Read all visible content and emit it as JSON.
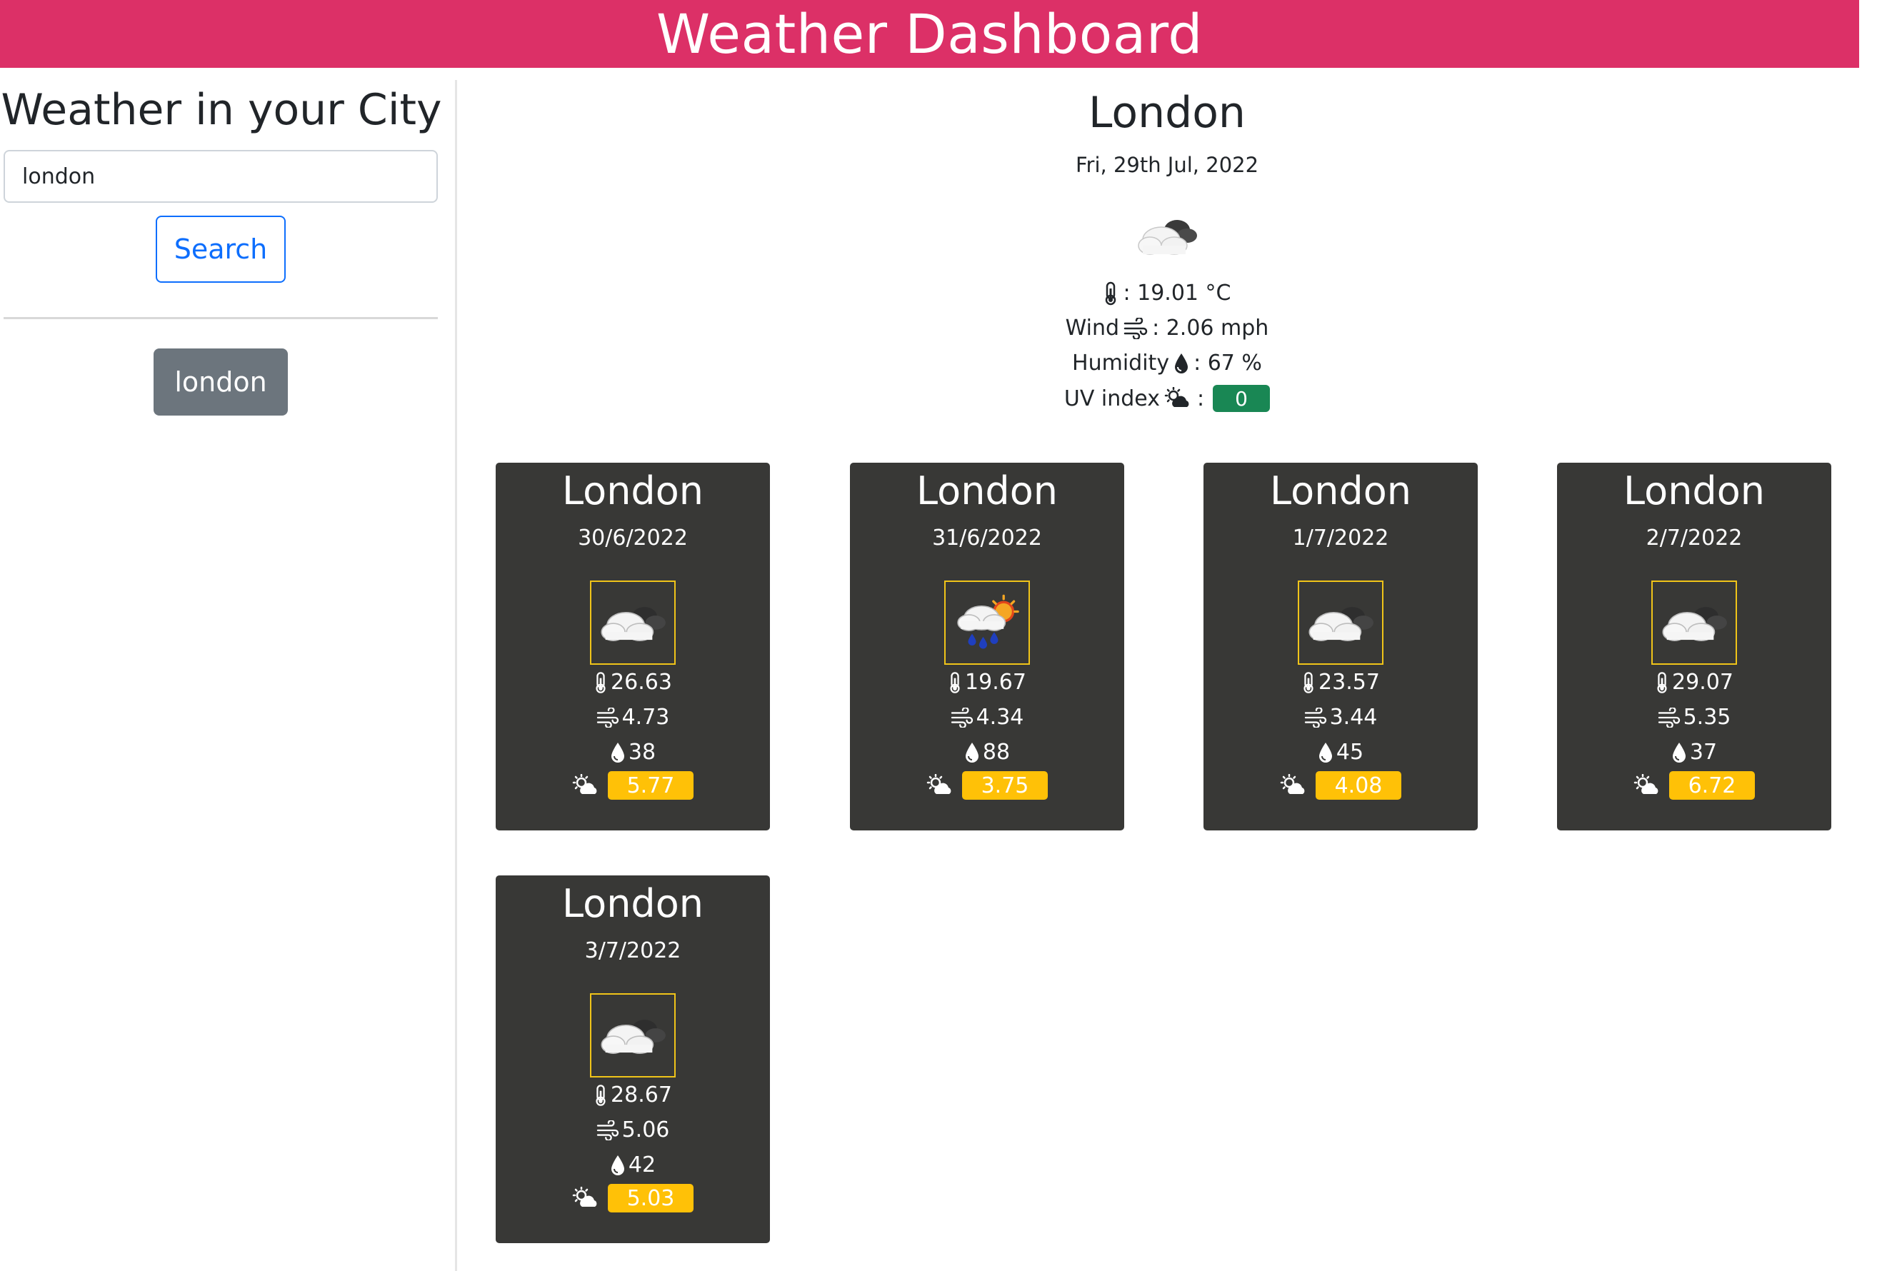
{
  "header": {
    "title": "Weather Dashboard"
  },
  "sidebar": {
    "title": "Weather in your City",
    "search_value": "london",
    "search_button_label": "Search",
    "history": [
      "london"
    ]
  },
  "current": {
    "city": "London",
    "date": "Fri, 29th Jul, 2022",
    "icon": "cloudy-icon",
    "temp": ": 19.01 °C",
    "wind_label": "Wind",
    "wind": ": 2.06 mph",
    "humidity_label": "Humidity",
    "humidity": ": 67 %",
    "uv_label": "UV index",
    "uv_sep": ":",
    "uv": "0",
    "uv_color": "#198754"
  },
  "forecast": [
    {
      "city": "London",
      "date": "30/6/2022",
      "icon": "cloudy-icon",
      "temp": "26.63",
      "wind": "4.73",
      "humidity": "38",
      "uv": "5.77"
    },
    {
      "city": "London",
      "date": "31/6/2022",
      "icon": "rain-sun-icon",
      "temp": "19.67",
      "wind": "4.34",
      "humidity": "88",
      "uv": "3.75"
    },
    {
      "city": "London",
      "date": "1/7/2022",
      "icon": "cloudy-icon",
      "temp": "23.57",
      "wind": "3.44",
      "humidity": "45",
      "uv": "4.08"
    },
    {
      "city": "London",
      "date": "2/7/2022",
      "icon": "cloudy-icon",
      "temp": "29.07",
      "wind": "5.35",
      "humidity": "37",
      "uv": "6.72"
    },
    {
      "city": "London",
      "date": "3/7/2022",
      "icon": "cloudy-icon",
      "temp": "28.67",
      "wind": "5.06",
      "humidity": "42",
      "uv": "5.03"
    }
  ],
  "colors": {
    "header_bg": "#dc3067",
    "card_bg": "#383836",
    "uv_moderate": "#ffc107",
    "uv_low": "#198754",
    "primary": "#0d6efd",
    "secondary": "#6c757d"
  }
}
